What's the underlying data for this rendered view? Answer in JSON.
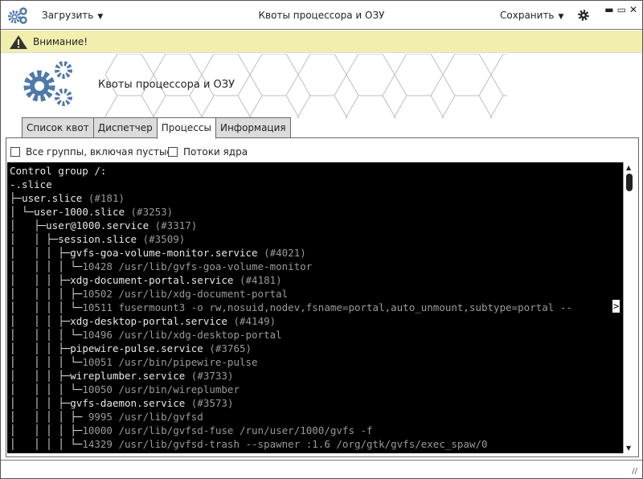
{
  "titlebar": {
    "load_label": "Загрузить",
    "title": "Квоты процессора и ОЗУ",
    "save_label": "Сохранить"
  },
  "warning": {
    "text": "Внимание!",
    "color": "#f2eeae"
  },
  "banner": {
    "title": "Квоты процессора и ОЗУ",
    "icon_color": "#4f79a8"
  },
  "tabs": [
    {
      "label": "Список квот"
    },
    {
      "label": "Диспетчер"
    },
    {
      "label": "Процессы",
      "active": true
    },
    {
      "label": "Информация"
    }
  ],
  "options": {
    "all_groups": {
      "label": "Все группы, включая пустые",
      "checked": false
    },
    "kernel_threads": {
      "label": "Потоки ядра",
      "checked": false
    }
  },
  "terminal": {
    "lines": [
      {
        "tree": "",
        "name": "Control group /:",
        "extra": ""
      },
      {
        "tree": "",
        "name": "-.slice",
        "extra": ""
      },
      {
        "tree": "├─",
        "name": "user.slice",
        "extra": " (#181)"
      },
      {
        "tree": "│ └─",
        "name": "user-1000.slice",
        "extra": " (#3253)"
      },
      {
        "tree": "│   ├─",
        "name": "user@1000.service",
        "extra": " (#3317)"
      },
      {
        "tree": "│   │ ├─",
        "name": "session.slice",
        "extra": " (#3509)"
      },
      {
        "tree": "│   │ │ ├─",
        "name": "gvfs-goa-volume-monitor.service",
        "extra": " (#4021)"
      },
      {
        "tree": "│   │ │ │ └─",
        "name": "",
        "extra": "10428 /usr/lib/gvfs-goa-volume-monitor"
      },
      {
        "tree": "│   │ │ ├─",
        "name": "xdg-document-portal.service",
        "extra": " (#4181)"
      },
      {
        "tree": "│   │ │ │ ├─",
        "name": "",
        "extra": "10502 /usr/lib/xdg-document-portal"
      },
      {
        "tree": "│   │ │ │ └─",
        "name": "",
        "extra": "10511 fusermount3 -o rw,nosuid,nodev,fsname=portal,auto_unmount,subtype=portal --"
      },
      {
        "tree": "│   │ │ ├─",
        "name": "xdg-desktop-portal.service",
        "extra": " (#4149)"
      },
      {
        "tree": "│   │ │ │ └─",
        "name": "",
        "extra": "10496 /usr/lib/xdg-desktop-portal"
      },
      {
        "tree": "│   │ │ ├─",
        "name": "pipewire-pulse.service",
        "extra": " (#3765)"
      },
      {
        "tree": "│   │ │ │ └─",
        "name": "",
        "extra": "10051 /usr/bin/pipewire-pulse"
      },
      {
        "tree": "│   │ │ ├─",
        "name": "wireplumber.service",
        "extra": " (#3733)"
      },
      {
        "tree": "│   │ │ │ └─",
        "name": "",
        "extra": "10050 /usr/bin/wireplumber"
      },
      {
        "tree": "│   │ │ ├─",
        "name": "gvfs-daemon.service",
        "extra": " (#3573)"
      },
      {
        "tree": "│   │ │ │ ├─",
        "name": "",
        "extra": " 9995 /usr/lib/gvfsd"
      },
      {
        "tree": "│   │ │ │ ├─",
        "name": "",
        "extra": "10000 /usr/lib/gvfsd-fuse /run/user/1000/gvfs -f"
      },
      {
        "tree": "│   │ │ │ └─",
        "name": "",
        "extra": "14329 /usr/lib/gvfsd-trash --spawner :1.6 /org/gtk/gvfs/exec_spaw/0"
      }
    ],
    "truncation_marker": ">"
  }
}
